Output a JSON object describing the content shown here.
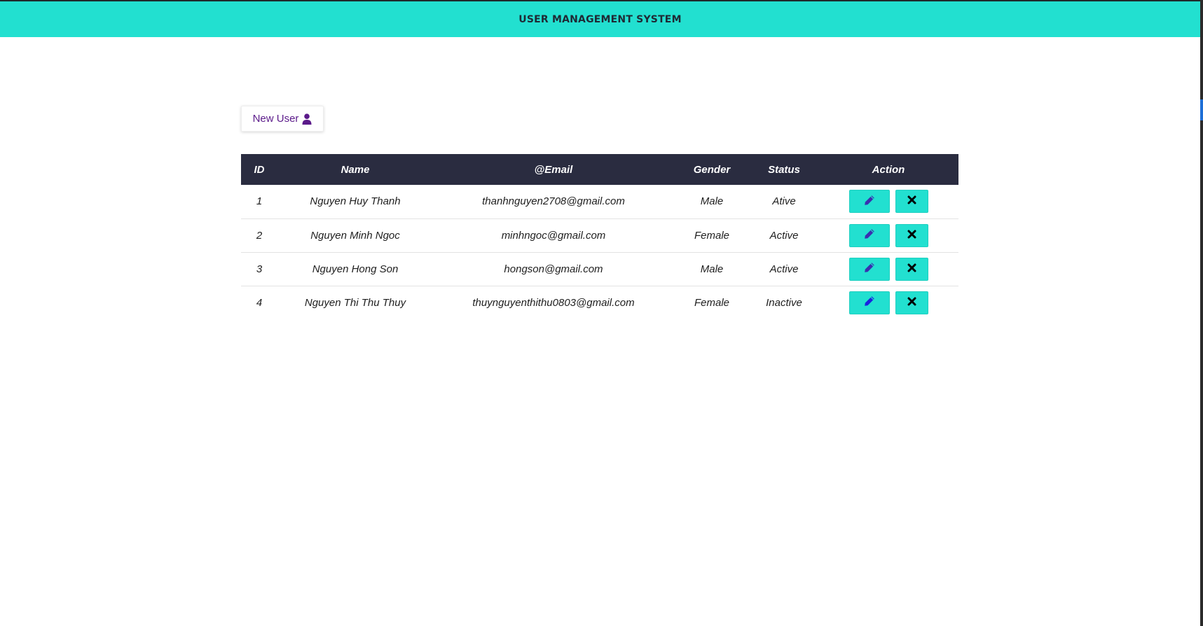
{
  "header": {
    "title": "USER MANAGEMENT SYSTEM"
  },
  "toolbar": {
    "new_user_label": "New User",
    "new_user_icon": "user-icon"
  },
  "table": {
    "columns": [
      "ID",
      "Name",
      "@Email",
      "Gender",
      "Status",
      "Action"
    ],
    "rows": [
      {
        "id": "1",
        "name": "Nguyen Huy Thanh",
        "email": "thanhnguyen2708@gmail.com",
        "gender": "Male",
        "status": "Ative"
      },
      {
        "id": "2",
        "name": "Nguyen Minh Ngoc",
        "email": "minhngoc@gmail.com",
        "gender": "Female",
        "status": "Active"
      },
      {
        "id": "3",
        "name": "Nguyen Hong Son",
        "email": "hongson@gmail.com",
        "gender": "Male",
        "status": "Active"
      },
      {
        "id": "4",
        "name": "Nguyen Thi Thu Thuy",
        "email": "thuynguyenthithu0803@gmail.com",
        "gender": "Female",
        "status": "Inactive"
      }
    ],
    "row_actions": {
      "edit_icon": "pencil-icon",
      "delete_icon": "close-icon"
    }
  },
  "colors": {
    "header_bg": "#22e0d0",
    "table_header_bg": "#2a2c40",
    "new_user_text": "#5b1a8a",
    "edit_icon": "#3a2fb0",
    "delete_icon": "#000000"
  }
}
